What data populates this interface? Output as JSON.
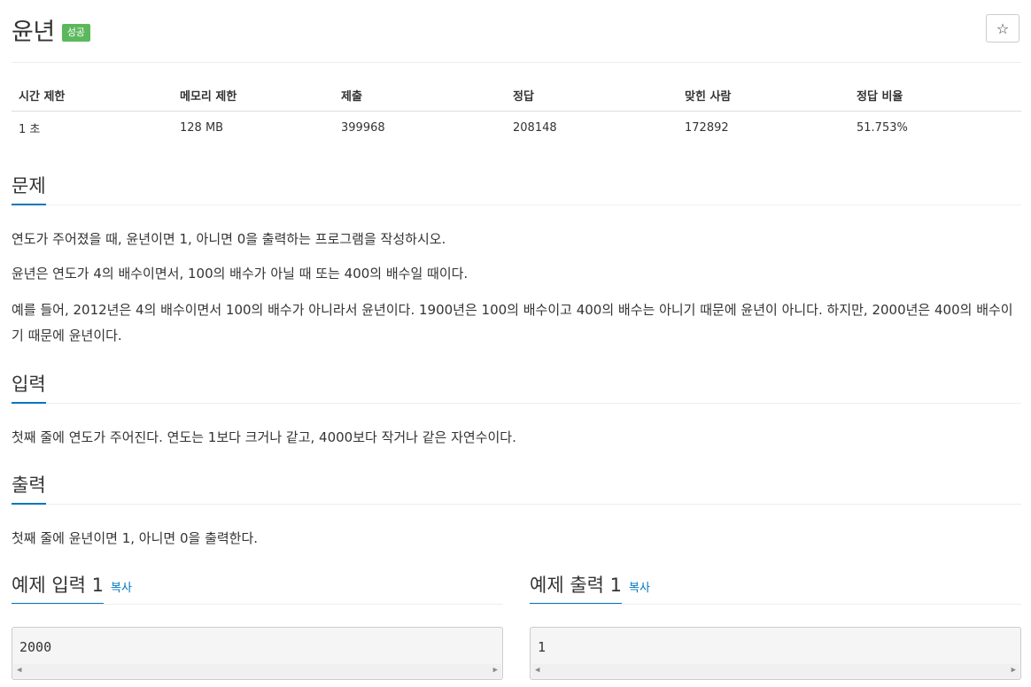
{
  "problem": {
    "title": "윤년",
    "badge": "성공"
  },
  "star_icon": "star-icon",
  "stats": {
    "headers": [
      "시간 제한",
      "메모리 제한",
      "제출",
      "정답",
      "맞힌 사람",
      "정답 비율"
    ],
    "values": [
      "1 초",
      "128 MB",
      "399968",
      "208148",
      "172892",
      "51.753%"
    ]
  },
  "sections": {
    "problem_heading": "문제",
    "problem_p1": "연도가 주어졌을 때, 윤년이면 1, 아니면 0을 출력하는 프로그램을 작성하시오.",
    "problem_p2": "윤년은 연도가 4의 배수이면서, 100의 배수가 아닐 때 또는 400의 배수일 때이다.",
    "problem_p3": "예를 들어, 2012년은 4의 배수이면서 100의 배수가 아니라서 윤년이다. 1900년은 100의 배수이고 400의 배수는 아니기 때문에 윤년이 아니다. 하지만, 2000년은 400의 배수이기 때문에 윤년이다.",
    "input_heading": "입력",
    "input_p": "첫째 줄에 연도가 주어진다. 연도는 1보다 크거나 같고, 4000보다 작거나 같은 자연수이다.",
    "output_heading": "출력",
    "output_p": "첫째 줄에 윤년이면 1, 아니면 0을 출력한다."
  },
  "samples": {
    "input_heading": "예제 입력 1",
    "output_heading": "예제 출력 1",
    "copy_label": "복사",
    "input_value": "2000",
    "output_value": "1"
  }
}
